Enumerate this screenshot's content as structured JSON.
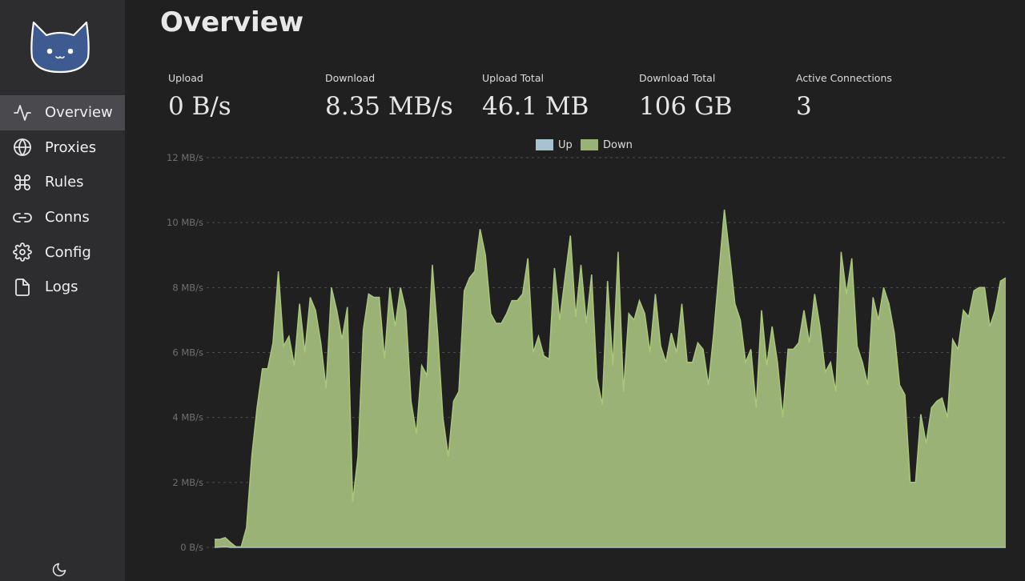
{
  "nav": {
    "items": [
      {
        "label": "Overview",
        "icon": "activity-icon",
        "active": true
      },
      {
        "label": "Proxies",
        "icon": "globe-icon",
        "active": false
      },
      {
        "label": "Rules",
        "icon": "command-icon",
        "active": false
      },
      {
        "label": "Conns",
        "icon": "link-icon",
        "active": false
      },
      {
        "label": "Config",
        "icon": "settings-icon",
        "active": false
      },
      {
        "label": "Logs",
        "icon": "file-icon",
        "active": false
      }
    ]
  },
  "header": {
    "title": "Overview"
  },
  "stats": [
    {
      "label": "Upload",
      "value": "0 B/s"
    },
    {
      "label": "Download",
      "value": "8.35 MB/s"
    },
    {
      "label": "Upload Total",
      "value": "46.1 MB"
    },
    {
      "label": "Download Total",
      "value": "106 GB"
    },
    {
      "label": "Active Connections",
      "value": "3"
    }
  ],
  "colors": {
    "sidebar_bg": "#2d2d30",
    "page_bg": "#202020",
    "up": "#a8c3d0",
    "down": "#9ab275",
    "down_line": "#a9c77a",
    "logo": "#3d5a91"
  },
  "chart_data": {
    "type": "area",
    "legend": [
      "Up",
      "Down"
    ],
    "legend_position": "top-center",
    "ylim": [
      0,
      12
    ],
    "yticks": [
      "0 B/s",
      "2 MB/s",
      "4 MB/s",
      "6 MB/s",
      "8 MB/s",
      "10 MB/s",
      "12 MB/s"
    ],
    "grid": true,
    "series": [
      {
        "name": "Up",
        "values": [
          0,
          0.01,
          0.02,
          0,
          0,
          0,
          0,
          0,
          0,
          0,
          0,
          0,
          0,
          0,
          0,
          0,
          0,
          0,
          0,
          0,
          0,
          0,
          0,
          0,
          0,
          0,
          0,
          0,
          0,
          0,
          0,
          0,
          0,
          0,
          0,
          0,
          0,
          0,
          0,
          0,
          0,
          0,
          0,
          0,
          0,
          0,
          0,
          0,
          0,
          0,
          0,
          0,
          0,
          0,
          0,
          0,
          0,
          0,
          0,
          0,
          0,
          0,
          0,
          0,
          0,
          0,
          0,
          0,
          0,
          0,
          0,
          0,
          0,
          0,
          0,
          0,
          0,
          0,
          0,
          0,
          0,
          0,
          0,
          0,
          0,
          0,
          0,
          0,
          0,
          0,
          0,
          0,
          0,
          0,
          0,
          0,
          0,
          0,
          0,
          0,
          0,
          0,
          0,
          0,
          0,
          0,
          0,
          0,
          0,
          0,
          0,
          0,
          0,
          0,
          0,
          0,
          0,
          0,
          0,
          0,
          0,
          0,
          0,
          0,
          0,
          0,
          0,
          0,
          0,
          0,
          0,
          0,
          0,
          0,
          0,
          0,
          0,
          0,
          0,
          0,
          0,
          0,
          0,
          0,
          0,
          0,
          0,
          0,
          0,
          0
        ]
      },
      {
        "name": "Down",
        "values": [
          0.25,
          0.25,
          0.3,
          0.15,
          0.02,
          0.02,
          0.6,
          2.8,
          4.3,
          5.5,
          5.5,
          6.3,
          8.5,
          6.2,
          6.5,
          5.6,
          7.5,
          6.0,
          7.7,
          7.3,
          6.3,
          4.9,
          8.0,
          7.3,
          6.4,
          7.4,
          1.4,
          2.8,
          6.7,
          7.8,
          7.7,
          7.7,
          5.8,
          8.0,
          6.8,
          8.0,
          7.3,
          4.5,
          3.5,
          5.6,
          5.3,
          8.7,
          6.6,
          4.0,
          2.8,
          4.5,
          4.8,
          7.9,
          8.3,
          8.5,
          9.8,
          9.0,
          7.2,
          6.9,
          6.9,
          7.2,
          7.6,
          7.6,
          7.8,
          8.9,
          6.0,
          6.5,
          5.9,
          5.8,
          8.6,
          7.0,
          8.3,
          9.6,
          7.1,
          8.7,
          6.9,
          8.4,
          5.2,
          4.4,
          8.2,
          5.6,
          9.1,
          4.8,
          7.2,
          7.0,
          7.6,
          7.2,
          6.0,
          7.8,
          6.2,
          5.7,
          6.6,
          6.0,
          7.5,
          5.7,
          5.7,
          6.3,
          6.1,
          5.0,
          6.6,
          8.5,
          10.4,
          9.0,
          7.5,
          7.0,
          5.7,
          6.1,
          4.3,
          7.3,
          5.6,
          6.8,
          5.7,
          4.0,
          6.1,
          6.1,
          6.3,
          7.3,
          6.3,
          7.8,
          6.8,
          5.4,
          5.7,
          4.8,
          9.1,
          7.8,
          8.9,
          6.2,
          5.7,
          5.0,
          7.7,
          7.0,
          8.0,
          7.5,
          6.6,
          5.0,
          4.7,
          2.0,
          2.0,
          4.1,
          3.2,
          4.3,
          4.5,
          4.6,
          4.0,
          6.4,
          6.1,
          7.3,
          7.1,
          7.9,
          8.0,
          8.0,
          6.8,
          7.3,
          8.2,
          8.3
        ]
      }
    ]
  }
}
